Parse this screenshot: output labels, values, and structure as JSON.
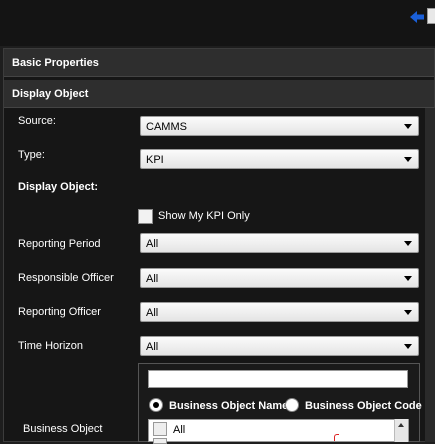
{
  "toolbar": {
    "back_icon": "back-arrow-icon",
    "save_icon": "save-icon"
  },
  "sections": {
    "basic_properties": "Basic Properties",
    "display_object": "Display Object"
  },
  "form": {
    "source_label": "Source:",
    "source_value": "CAMMS",
    "type_label": "Type:",
    "type_value": "KPI",
    "display_object_label": "Display Object:",
    "show_my_kpi_label": "Show My KPI Only",
    "reporting_period_label": "Reporting Period",
    "reporting_period_value": "All",
    "responsible_officer_label": "Responsible Officer",
    "responsible_officer_value": "All",
    "reporting_officer_label": "Reporting Officer",
    "reporting_officer_value": "All",
    "time_horizon_label": "Time Horizon",
    "time_horizon_value": "All",
    "business_object_label": "Business Object"
  },
  "business_object": {
    "search_value": "",
    "radio_name_label": "Business Object Name",
    "radio_code_label": "Business Object Code",
    "selected_radio": "name",
    "list_items": [
      "All"
    ]
  },
  "colors": {
    "accent_blue": "#1a5fd8",
    "panel_bg": "#161616",
    "section_bg": "#2e2e2e"
  }
}
